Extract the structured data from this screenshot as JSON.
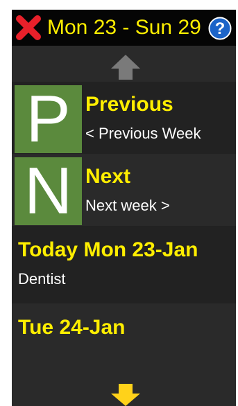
{
  "header": {
    "title": "Mon 23 - Sun 29",
    "close_icon": "close-icon",
    "help_icon": "help-icon",
    "close_color": "#e8202a",
    "help_color": "#1c64c8"
  },
  "scroll": {
    "up_icon": "arrow-up-icon",
    "up_color": "#7a7a7a",
    "down_icon": "arrow-down-icon",
    "down_color": "#ffd21a"
  },
  "nav": {
    "previous": {
      "letter": "P",
      "title": "Previous",
      "subtitle": "< Previous Week"
    },
    "next": {
      "letter": "N",
      "title": "Next",
      "subtitle": "Next week >"
    }
  },
  "days": [
    {
      "title": "Today Mon  23-Jan",
      "event": "Dentist"
    },
    {
      "title": "Tue  24-Jan",
      "event": ""
    }
  ],
  "colors": {
    "accent_yellow": "#ffee00",
    "tile_green": "#5b8a3d"
  }
}
